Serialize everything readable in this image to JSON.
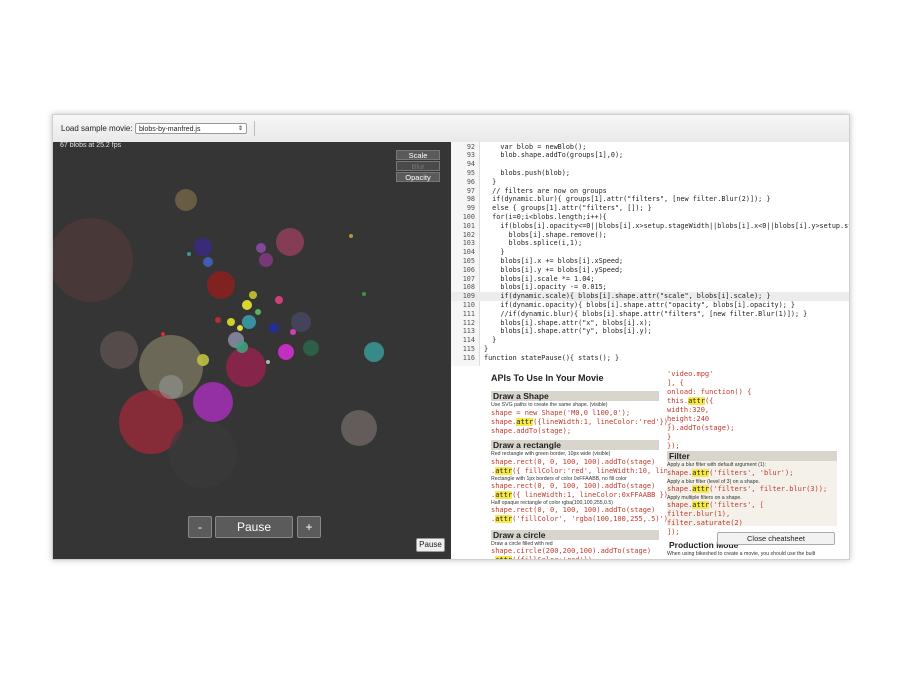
{
  "toolbar": {
    "load_label": "Load sample movie:",
    "movie_select": "blobs-by-manfred.js"
  },
  "stage": {
    "fps_text": "67 blobs at 25.2 fps",
    "toggles": [
      {
        "label": "Scale",
        "active": true
      },
      {
        "label": "Blur",
        "active": false
      },
      {
        "label": "Opacity",
        "active": true
      }
    ],
    "minus_label": "-",
    "pause_label": "Pause",
    "plus_label": "+",
    "small_pause_label": "Pause"
  },
  "editor": {
    "lines": [
      {
        "n": "92",
        "t": "    var blob = newBlob();"
      },
      {
        "n": "93",
        "t": "    blob.shape.addTo(groups[1],0);"
      },
      {
        "n": "94",
        "t": ""
      },
      {
        "n": "95",
        "t": "    blobs.push(blob);"
      },
      {
        "n": "96",
        "t": "  }"
      },
      {
        "n": "97",
        "t": "  // filters are now on groups"
      },
      {
        "n": "98",
        "t": "  if(dynamic.blur){ groups[1].attr(\"filters\", [new filter.Blur(2)]); }"
      },
      {
        "n": "99",
        "t": "  else { groups[1].attr(\"filters\", []); }"
      },
      {
        "n": "100",
        "t": "  for(i=0;i<blobs.length;i++){"
      },
      {
        "n": "101",
        "t": "    if(blobs[i].opacity<=0||blobs[i].x>setup.stageWidth||blobs[i].x<0||blobs[i].y>setup.stageHe"
      },
      {
        "n": "102",
        "t": "      blobs[i].shape.remove();"
      },
      {
        "n": "103",
        "t": "      blobs.splice(i,1);"
      },
      {
        "n": "104",
        "t": "    }"
      },
      {
        "n": "105",
        "t": "    blobs[i].x += blobs[i].xSpeed;"
      },
      {
        "n": "106",
        "t": "    blobs[i].y += blobs[i].ySpeed;"
      },
      {
        "n": "107",
        "t": "    blobs[i].scale *= 1.04;"
      },
      {
        "n": "108",
        "t": "    blobs[i].opacity -= 0.015;"
      },
      {
        "n": "109",
        "t": "    if(dynamic.scale){ blobs[i].shape.attr(\"scale\", blobs[i].scale); }"
      },
      {
        "n": "110",
        "t": "    if(dynamic.opacity){ blobs[i].shape.attr(\"opacity\", blobs[i].opacity); }"
      },
      {
        "n": "111",
        "t": "    //if(dynamic.blur){ blobs[i].shape.attr(\"filters\", [new filter.Blur(1)]); }"
      },
      {
        "n": "112",
        "t": "    blobs[i].shape.attr(\"x\", blobs[i].x);"
      },
      {
        "n": "113",
        "t": "    blobs[i].shape.attr(\"y\", blobs[i].y);"
      },
      {
        "n": "114",
        "t": "  }"
      },
      {
        "n": "115",
        "t": "}"
      },
      {
        "n": "116",
        "t": "function statePause(){ stats(); }"
      }
    ],
    "highlight_line": "109"
  },
  "cheatsheet": {
    "title": "APIs To Use In Your Movie",
    "draw_shape": {
      "heading": "Draw a Shape",
      "desc": "Use SVG paths to create the same shape. (visible)",
      "code": [
        "shape = new Shape('M0,0 l100,0');",
        "shape.attr({lineWidth:1, lineColor:'red'});",
        "shape.addTo(stage);"
      ]
    },
    "draw_rect": {
      "heading": "Draw a rectangle",
      "desc1": "Red rectangle with green border, 10px wide (visible)",
      "code1": [
        "shape.rect(0, 0, 100, 100).addTo(stage)",
        "  .attr({ fillColor:'red', lineWidth:10, lin"
      ],
      "desc2": "Rectangle with 1px borders of color 0xFFAABB, no fill color",
      "code2": [
        "shape.rect(0, 0, 100, 100).addTo(stage)",
        "  .attr({ lineWidth:1, lineColor:0xFFAABB })"
      ],
      "desc3": "Half opaque rectangle of color rgba(100,100,255,0.5)",
      "code3": [
        "shape.rect(0, 0, 100, 100).addTo(stage)",
        "  .attr('fillColor', 'rgba(100,100,255,.5)')"
      ]
    },
    "draw_circle": {
      "heading": "Draw a circle",
      "desc": "Draw a circle filled with red",
      "code": [
        "shape.circle(200,200,100).addTo(stage)",
        "  .attr({fillColor:'red'})"
      ]
    },
    "video": {
      "code": [
        "  'video.mpg'",
        "], {",
        "   onload: function() {",
        "     this.attr({",
        "       width:320,",
        "       height:240",
        "     }).addTo(stage);",
        "   }",
        "});"
      ]
    },
    "filter": {
      "heading": "Filter",
      "desc1": "Apply a blur filter with default argument (1):",
      "code1": "shape.attr('filters', 'blur');",
      "desc2": "Apply a blur filter (level of 3) on a shape.",
      "code2": "shape.attr('filters', filter.blur(3));",
      "desc3": "Apply multiple filters on a shape.",
      "code3": [
        "shape.attr('filters', [",
        "   filter.blur(1),",
        "   filter.saturate(2)",
        "]);"
      ]
    },
    "production": {
      "heading": "Production Mode",
      "desc": "When using bikeshed to create a movie, you should use the built"
    },
    "close_label": "Close cheatsheet"
  },
  "colors": {
    "stage_bg": "#353535",
    "code_red": "#c0392b",
    "method_highlight": "#f6e84a",
    "section_bg": "#d8d5cc"
  }
}
